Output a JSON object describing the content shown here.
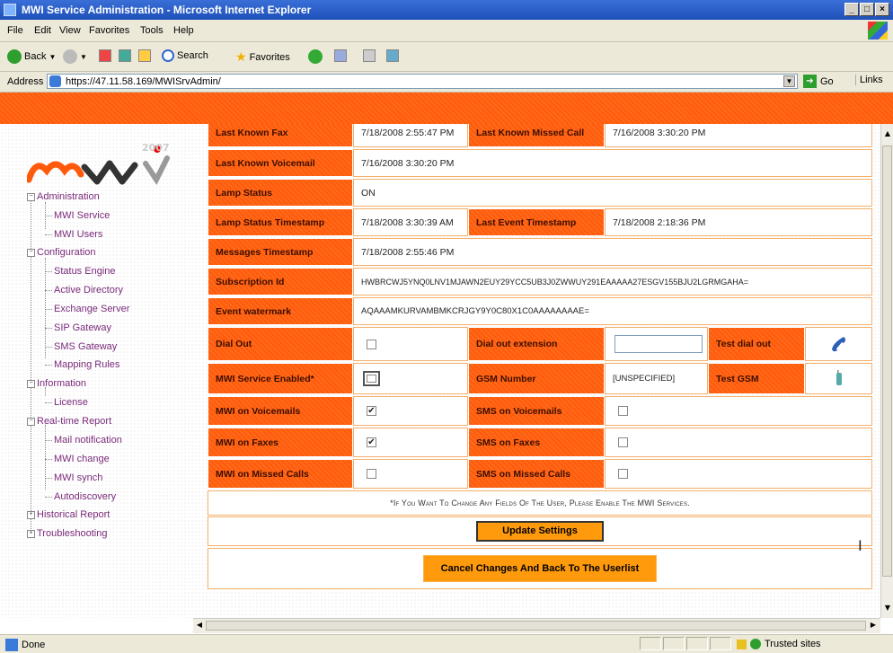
{
  "window": {
    "title": "MWI Service Administration - Microsoft Internet Explorer",
    "controls": [
      "_",
      "□",
      "×"
    ]
  },
  "menu": [
    "File",
    "Edit",
    "View",
    "Favorites",
    "Tools",
    "Help"
  ],
  "toolbar": {
    "back": "Back",
    "search": "Search",
    "favorites": "Favorites"
  },
  "address": {
    "label": "Address",
    "url": "https://47.11.58.169/MWISrvAdmin/",
    "go": "Go",
    "links": "Links"
  },
  "sidebar": {
    "logo_text": "mwi",
    "logo_year": "2007",
    "items": [
      {
        "label": "Administration",
        "toggle": "⊟"
      },
      {
        "label": "MWI Service"
      },
      {
        "label": "MWI Users"
      },
      {
        "label": "Configuration",
        "toggle": "⊟"
      },
      {
        "label": "Status Engine"
      },
      {
        "label": "Active Directory"
      },
      {
        "label": "Exchange Server"
      },
      {
        "label": "SIP Gateway"
      },
      {
        "label": "SMS Gateway"
      },
      {
        "label": "Mapping Rules"
      },
      {
        "label": "Information",
        "toggle": "⊟"
      },
      {
        "label": "License"
      },
      {
        "label": "Real-time Report",
        "toggle": "⊟"
      },
      {
        "label": "Mail notification"
      },
      {
        "label": "MWI change"
      },
      {
        "label": "MWI synch"
      },
      {
        "label": "Autodiscovery"
      },
      {
        "label": "Historical Report",
        "toggle": "⊞"
      },
      {
        "label": "Troubleshooting",
        "toggle": "⊞"
      }
    ]
  },
  "form": {
    "last_known_fax_label": "Last Known Fax",
    "last_known_fax": "7/18/2008 2:55:47 PM",
    "last_known_missed_call_label": "Last Known Missed Call",
    "last_known_missed_call": "7/16/2008 3:30:20 PM",
    "last_known_voicemail_label": "Last Known Voicemail",
    "last_known_voicemail": "7/16/2008 3:30:20 PM",
    "lamp_status_label": "Lamp Status",
    "lamp_status": "ON",
    "lamp_status_ts_label": "Lamp Status Timestamp",
    "lamp_status_ts": "7/18/2008 3:30:39 AM",
    "last_event_ts_label": "Last Event Timestamp",
    "last_event_ts": "7/18/2008 2:18:36 PM",
    "messages_ts_label": "Messages Timestamp",
    "messages_ts": "7/18/2008 2:55:46 PM",
    "subscription_id_label": "Subscription Id",
    "subscription_id": "HWBRCWJ5YNQ0LNV1MJAWN2EUY29YCC5UB3J0ZWWUY291EAAAAA27ESGV155BJU2LGRMGAHA=",
    "event_watermark_label": "Event watermark",
    "event_watermark": "AQAAAMKURVAMBMKCRJGY9Y0C80X1C0AAAAAAAAE=",
    "dial_out_label": "Dial Out",
    "dial_out_checked": false,
    "dial_out_ext_label": "Dial out extension",
    "dial_out_ext_value": "",
    "test_dial_out_label": "Test dial out",
    "mwi_enabled_label": "MWI Service Enabled*",
    "mwi_enabled_checked": false,
    "gsm_number_label": "GSM Number",
    "gsm_number": "[UNSPECIFIED]",
    "test_gsm_label": "Test GSM",
    "mwi_voicemails_label": "MWI on Voicemails",
    "mwi_voicemails_checked": true,
    "sms_voicemails_label": "SMS on Voicemails",
    "sms_voicemails_checked": false,
    "mwi_faxes_label": "MWI on Faxes",
    "mwi_faxes_checked": true,
    "sms_faxes_label": "SMS on Faxes",
    "sms_faxes_checked": false,
    "mwi_missed_label": "MWI on Missed Calls",
    "mwi_missed_checked": false,
    "sms_missed_label": "SMS on Missed Calls",
    "sms_missed_checked": false,
    "note": "*If You Want To Change Any Fields Of The User, Please Enable The MWI Services.",
    "update_button": "Update Settings",
    "cancel_button": "Cancel Changes And Back To The Userlist"
  },
  "checkmark": "✔",
  "status": {
    "text": "Done",
    "zone": "Trusted sites"
  },
  "colors": {
    "accent_orange": "#ff5f12",
    "button_orange": "#ff9a0c",
    "tree_link": "#7a2a7a"
  }
}
